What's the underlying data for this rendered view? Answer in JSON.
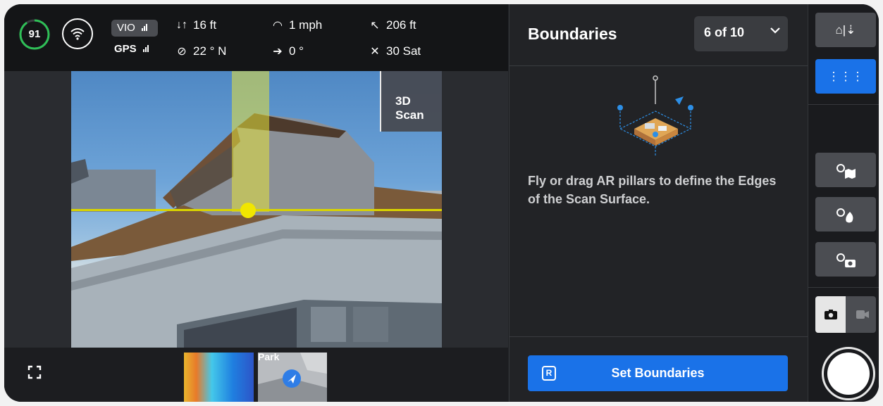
{
  "status": {
    "battery": "91",
    "vio_label": "VIO",
    "gps_label": "GPS",
    "altitude": "16 ft",
    "heading": "22 ° N",
    "speed": "1 mph",
    "gimbal": "0 °",
    "distance": "206 ft",
    "satellites": "30 Sat"
  },
  "camera": {
    "scan_label": "3D Scan",
    "map_thumb_label": "Park"
  },
  "panel": {
    "title": "Boundaries",
    "step": "6 of 10",
    "instruction": "Fly or drag AR pillars to define the Edges of the Scan Surface.",
    "button_key": "R",
    "button_label": "Set Boundaries"
  },
  "rail": {
    "home_label": "⌂|⇣",
    "grid_label": "⋮⋮⋮"
  },
  "colors": {
    "accent": "#1a72e8",
    "focus": "#f1e600",
    "battery_ring": "#2fbf57"
  }
}
